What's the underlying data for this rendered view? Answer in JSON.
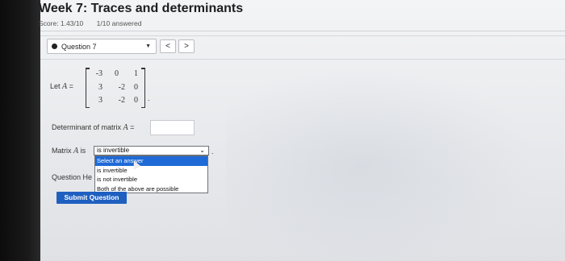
{
  "header": {
    "title": "Week 7: Traces and determinants",
    "score": "Score: 1.43/10",
    "answered": "1/10 answered"
  },
  "question_nav": {
    "selected": "Question 7",
    "prev_symbol": "<",
    "next_symbol": ">"
  },
  "matrix_prompt": {
    "let_text": "Let",
    "var_name": "A",
    "equals": "=",
    "rows": [
      [
        "-3",
        "0",
        "1"
      ],
      [
        "3",
        "-2",
        "0"
      ],
      [
        "3",
        "-2",
        "0"
      ]
    ],
    "period": "."
  },
  "determinant": {
    "label_prefix": "Determinant of matrix",
    "var_name": "A",
    "equals": "=",
    "value": ""
  },
  "invertible": {
    "label_prefix": "Matrix",
    "var_name": "A",
    "label_suffix": "is",
    "selected": "is invertible",
    "period": ".",
    "options": [
      "Select an answer",
      "is invertible",
      "is not invertible",
      "Both of the above are possible"
    ]
  },
  "help": {
    "label": "Question He"
  },
  "submit": {
    "label": "Submit Question"
  },
  "colors": {
    "accent": "#1f5fc0",
    "highlight": "#1f6ad6"
  }
}
